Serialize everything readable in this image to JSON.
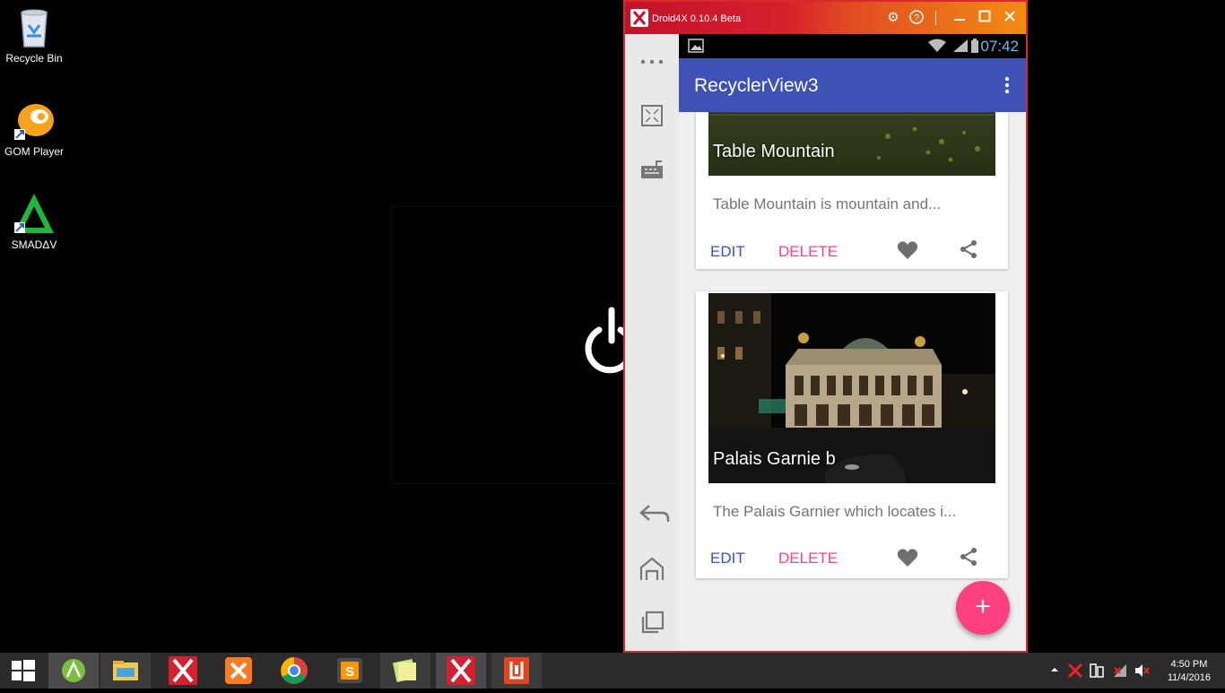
{
  "desktop": {
    "icons": [
      {
        "label": "Recycle Bin",
        "icon": "recycle-bin-icon"
      },
      {
        "label": "GOM Player",
        "icon": "gom-player-icon"
      },
      {
        "label": "SMADΔV",
        "icon": "smadav-icon"
      }
    ]
  },
  "emulator": {
    "title": "Droid4X 0.10.4 Beta",
    "status_time": "07:42",
    "app_title": "RecyclerView3",
    "cards": [
      {
        "caption": "Table Mountain",
        "description": "Table Mountain is mountain and...",
        "edit_label": "EDIT",
        "delete_label": "DELETE"
      },
      {
        "caption": "Palais Garnie b",
        "description": "The Palais Garnier which locates i...",
        "edit_label": "EDIT",
        "delete_label": "DELETE"
      }
    ],
    "fab_label": "+"
  },
  "taskbar": {
    "time": "4:50 PM",
    "date": "11/4/2016"
  },
  "colors": {
    "primary": "#3f51b5",
    "accent": "#ff4081",
    "status_text": "#5fc2ef",
    "emulator_frame": "#d72a2a"
  }
}
